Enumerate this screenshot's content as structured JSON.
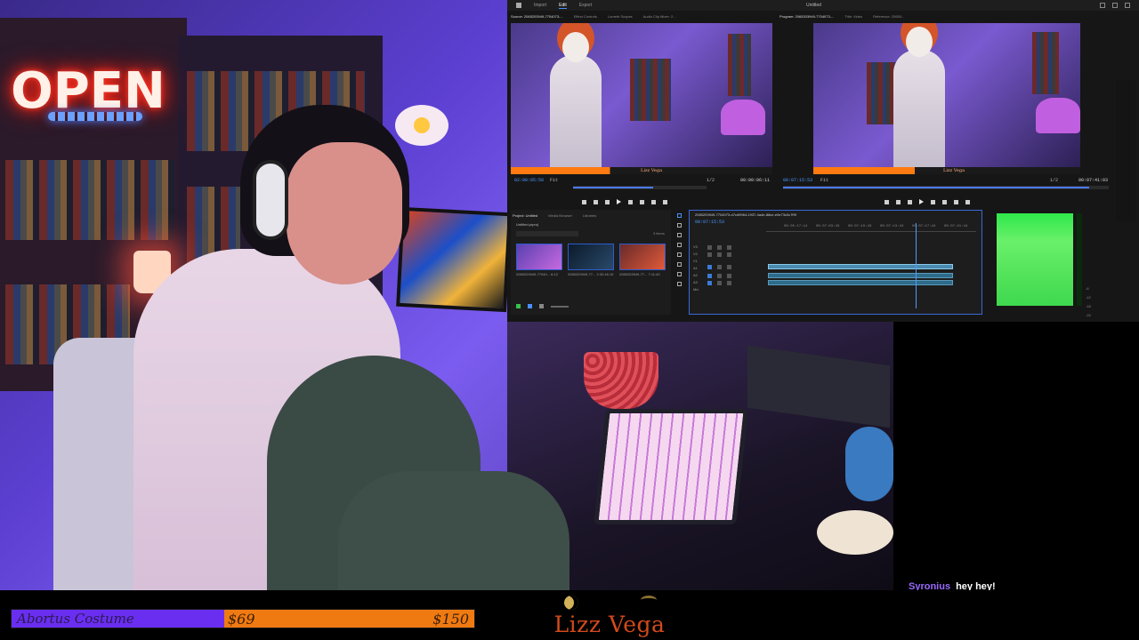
{
  "overlay": {
    "goal": {
      "label": "Abortus Costume",
      "current": "$69",
      "target": "$150",
      "progress": 0.46,
      "fill_color": "#6a2ef0",
      "bar_color": "#f07a12"
    },
    "brand": {
      "name": "Lizz Vega",
      "color": "#d24a1a"
    },
    "neon_sign": "OPEN"
  },
  "chat": {
    "user": "Syronius",
    "message": "hey hey!",
    "user_color": "#9a6aff"
  },
  "editor": {
    "window_title": "Untitled",
    "workspace_tabs": [
      "Import",
      "Edit",
      "Export"
    ],
    "active_tab": "Edit",
    "source_panel_tabs": [
      "Source: 2065203949-7704073-...",
      "Effect Controls",
      "Lumetri Scopes",
      "Audio Clip Mixer: 2..."
    ],
    "program_panel_tabs": [
      "Program: 2065203949-7704073-...",
      "Title: Video",
      "Reference: 20650..."
    ],
    "source_timecode": "02:00:05:50",
    "source_duration": "00:00:06:11",
    "program_timecode": "00:07:15:53",
    "program_duration": "00:07:41:03",
    "source_caption": "Lizz Vega",
    "program_caption": "Lizz Vega",
    "fit_label": "Fit",
    "fraction": "1/2",
    "project_tabs": [
      "Project: Untitled",
      "Media Browser",
      "Libraries"
    ],
    "project_name": "Untitled.prproj",
    "project_items_count": "3 items",
    "clips": [
      {
        "name": "2065203949-77040...",
        "duration": "6:12"
      },
      {
        "name": "2065203949-77...",
        "duration": "2:32:46:10"
      },
      {
        "name": "2065203949-77...",
        "duration": "7:11:40"
      }
    ],
    "sequence_name": "2065203949-7704073-d7cd9964-1937-4a4e-88ce-e0e73c0c7f9f",
    "sequence_timecode": "00:07:15:53",
    "ruler_ticks": [
      "00:05:17:14",
      "00:07:03:43",
      "00:07:10:43",
      "00:07:13:44",
      "00:07:17:44",
      "00:07:21:44"
    ],
    "tracks": [
      "V3",
      "V2",
      "V1",
      "A1",
      "A2",
      "A3",
      "Mix"
    ],
    "meter_scale": [
      "-6",
      "-12",
      "-18",
      "-24"
    ]
  }
}
